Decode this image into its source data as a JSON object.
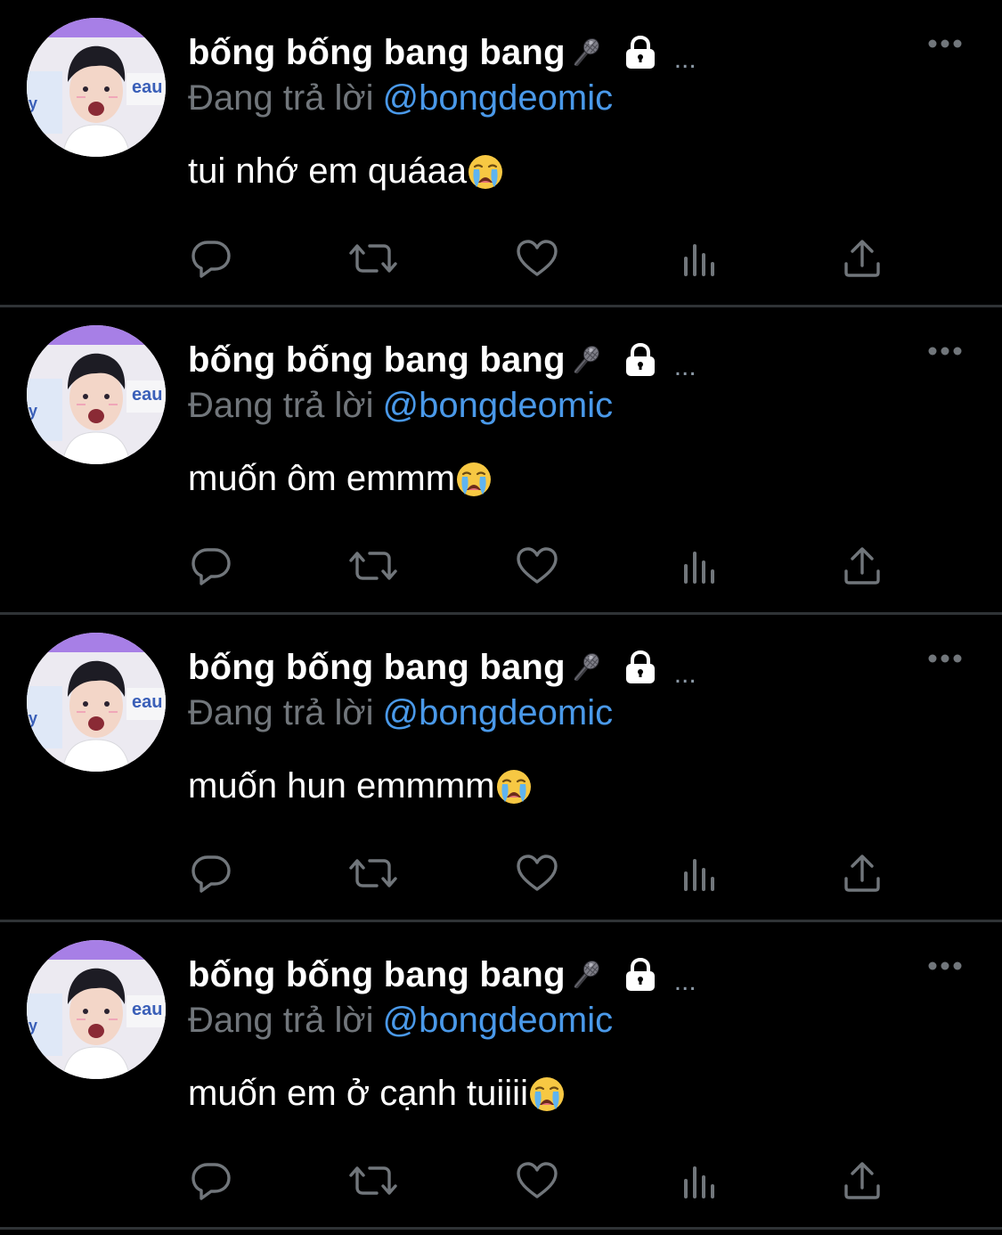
{
  "colors": {
    "background": "#000000",
    "divider": "#2f3336",
    "name": "#ffffff",
    "muted": "#71767b",
    "handle": "#4a99e9",
    "icon": "#71767b"
  },
  "tweets": [
    {
      "display_name": "bống bống bang bang",
      "name_emoji": "microphone-icon",
      "protected_icon": "lock-icon",
      "truncation": "...",
      "reply_prefix": "Đang trả lời",
      "reply_handle": "@bongdeomic",
      "text": "tui nhớ em quáaa",
      "text_emoji": "loudly-crying-face-icon"
    },
    {
      "display_name": "bống bống bang bang",
      "name_emoji": "microphone-icon",
      "protected_icon": "lock-icon",
      "truncation": "...",
      "reply_prefix": "Đang trả lời",
      "reply_handle": "@bongdeomic",
      "text": "muốn ôm emmm",
      "text_emoji": "loudly-crying-face-icon"
    },
    {
      "display_name": "bống bống bang bang",
      "name_emoji": "microphone-icon",
      "protected_icon": "lock-icon",
      "truncation": "...",
      "reply_prefix": "Đang trả lời",
      "reply_handle": "@bongdeomic",
      "text": "muốn hun emmmm",
      "text_emoji": "loudly-crying-face-icon"
    },
    {
      "display_name": "bống bống bang bang",
      "name_emoji": "microphone-icon",
      "protected_icon": "lock-icon",
      "truncation": "...",
      "reply_prefix": "Đang trả lời",
      "reply_handle": "@bongdeomic",
      "text": "muốn em ở cạnh tuiiii",
      "text_emoji": "loudly-crying-face-icon"
    }
  ],
  "action_icons": [
    "reply-icon",
    "retweet-icon",
    "like-icon",
    "views-icon",
    "share-icon"
  ]
}
